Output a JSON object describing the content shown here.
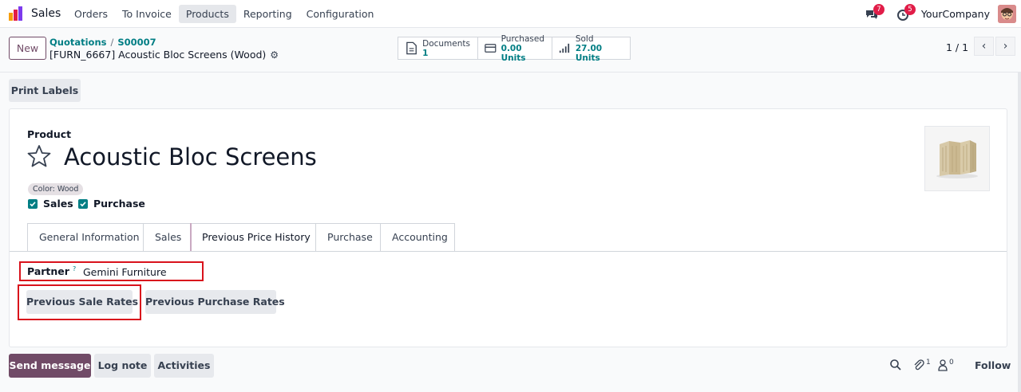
{
  "navbar": {
    "app_name": "Sales",
    "menu": [
      "Orders",
      "To Invoice",
      "Products",
      "Reporting",
      "Configuration"
    ],
    "active_menu": "Products",
    "messages_count": "7",
    "activities_count": "5",
    "company": "YourCompany"
  },
  "control_panel": {
    "new_label": "New",
    "breadcrumb": [
      "Quotations",
      "S00007"
    ],
    "breadcrumb_sep": "/",
    "record_title": "[FURN_6667] Acoustic Bloc Screens (Wood)",
    "smart_buttons": [
      {
        "label": "Documents",
        "value": "1",
        "icon": "document-icon"
      },
      {
        "label": "Purchased",
        "value": "0.00 Units",
        "icon": "credit-card-icon"
      },
      {
        "label": "Sold",
        "value": "27.00 Units",
        "icon": "signal-bars-icon"
      }
    ],
    "pager": "1 / 1"
  },
  "actions": {
    "print_labels": "Print Labels"
  },
  "form": {
    "product_label": "Product",
    "product_name": "Acoustic Bloc Screens",
    "attribute_tag": "Color: Wood",
    "checkboxes": [
      {
        "label": "Sales",
        "checked": true
      },
      {
        "label": "Purchase",
        "checked": true
      }
    ],
    "tabs": [
      "General Information",
      "Sales",
      "Previous Price History",
      "Purchase",
      "Accounting"
    ],
    "active_tab": "Previous Price History",
    "partner_label": "Partner",
    "partner_help": "?",
    "partner_value": "Gemini Furniture",
    "previous_sale_rates": "Previous Sale Rates",
    "previous_purchase_rates": "Previous Purchase Rates"
  },
  "chatter": {
    "send_message": "Send message",
    "log_note": "Log note",
    "activities": "Activities",
    "attachments_count": "1",
    "followers_count": "0",
    "follow": "Follow"
  },
  "colors": {
    "brand": "#714B67",
    "link": "#017e84",
    "highlight": "#d9121c"
  }
}
